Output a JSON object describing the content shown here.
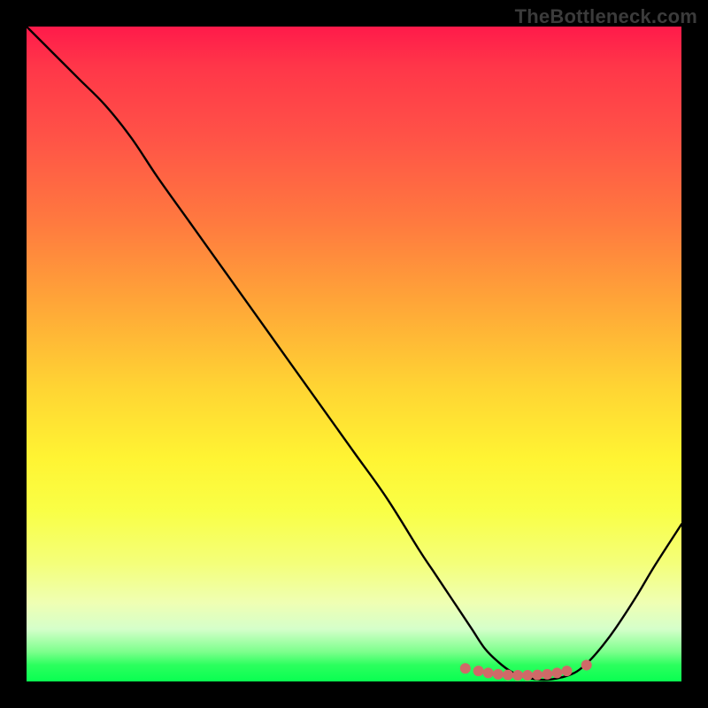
{
  "watermark": "TheBottleneck.com",
  "colors": {
    "curve_stroke": "#000000",
    "marker_fill": "#cf6a68",
    "marker_stroke": "#cf6a68",
    "frame": "#000000"
  },
  "chart_data": {
    "type": "line",
    "title": "",
    "xlabel": "",
    "ylabel": "",
    "xlim": [
      0,
      100
    ],
    "ylim": [
      0,
      100
    ],
    "grid": false,
    "legend": false,
    "series": [
      {
        "name": "bottleneck-curve",
        "x": [
          0,
          4,
          8,
          12,
          16,
          20,
          25,
          30,
          35,
          40,
          45,
          50,
          55,
          60,
          62,
          64,
          66,
          68,
          70,
          72,
          74,
          76,
          78,
          80,
          82,
          84,
          86,
          88,
          90,
          93,
          96,
          100
        ],
        "y": [
          100,
          96,
          92,
          88,
          83,
          77,
          70,
          63,
          56,
          49,
          42,
          35,
          28,
          20,
          17,
          14,
          11,
          8,
          5,
          3,
          1.5,
          0.7,
          0.3,
          0.3,
          0.7,
          1.5,
          3.2,
          5.5,
          8.2,
          12.8,
          17.8,
          24
        ]
      }
    ],
    "highlight_points": {
      "name": "optimal-range-markers",
      "x": [
        67,
        69,
        70.5,
        72,
        73.5,
        75,
        76.5,
        78,
        79.5,
        81,
        82.5,
        85.5
      ],
      "y": [
        2.0,
        1.6,
        1.3,
        1.1,
        1.0,
        0.95,
        0.95,
        1.0,
        1.1,
        1.3,
        1.6,
        2.5
      ]
    }
  }
}
